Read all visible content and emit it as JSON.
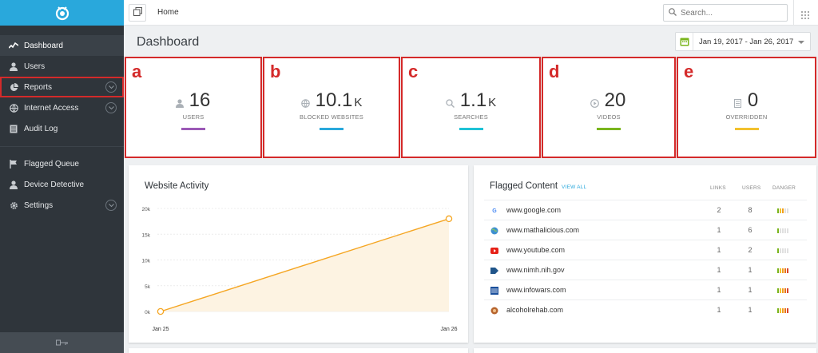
{
  "topbar": {
    "breadcrumb": "Home",
    "search_placeholder": "Search..."
  },
  "sidebar": {
    "items": [
      {
        "label": "Dashboard",
        "icon": "chart-line-icon"
      },
      {
        "label": "Users",
        "icon": "user-icon"
      },
      {
        "label": "Reports",
        "icon": "pie-chart-icon"
      },
      {
        "label": "Internet Access",
        "icon": "globe-icon"
      },
      {
        "label": "Audit Log",
        "icon": "list-icon"
      },
      {
        "label": "Flagged Queue",
        "icon": "flag-icon"
      },
      {
        "label": "Device Detective",
        "icon": "user-icon"
      },
      {
        "label": "Settings",
        "icon": "gear-icon"
      }
    ]
  },
  "header": {
    "title": "Dashboard",
    "date_range": "Jan 19, 2017 - Jan 26, 2017"
  },
  "stats": [
    {
      "letter": "a",
      "value": "16",
      "suffix": "",
      "label": "USERS",
      "color": "#9b59b6",
      "icon": "user-icon"
    },
    {
      "letter": "b",
      "value": "10.1",
      "suffix": "K",
      "label": "BLOCKED WEBSITES",
      "color": "#29a8dc",
      "icon": "globe-icon"
    },
    {
      "letter": "c",
      "value": "1.1",
      "suffix": "K",
      "label": "SEARCHES",
      "color": "#1fc2d6",
      "icon": "search-icon"
    },
    {
      "letter": "d",
      "value": "20",
      "suffix": "",
      "label": "VIDEOS",
      "color": "#7ab51d",
      "icon": "play-icon"
    },
    {
      "letter": "e",
      "value": "0",
      "suffix": "",
      "label": "OVERRIDDEN",
      "color": "#f2c12e",
      "icon": "document-icon"
    }
  ],
  "website_activity": {
    "title": "Website Activity",
    "chart_data": {
      "type": "area",
      "x": [
        "Jan 25",
        "Jan 26"
      ],
      "values": [
        0,
        18000
      ],
      "ylim": [
        0,
        20000
      ],
      "yticks": [
        "0k",
        "5k",
        "10k",
        "15k",
        "20k"
      ],
      "grid": true,
      "color": "#f5a623"
    }
  },
  "flagged_content": {
    "title": "Flagged Content",
    "view_all": "VIEW ALL",
    "columns": {
      "links": "LINKS",
      "users": "USERS",
      "danger": "DANGER"
    },
    "rows": [
      {
        "site": "www.google.com",
        "links": "2",
        "users": "8",
        "danger": 3,
        "icon": "google-icon"
      },
      {
        "site": "www.mathalicious.com",
        "links": "1",
        "users": "6",
        "danger": 1,
        "icon": "globe-icon"
      },
      {
        "site": "www.youtube.com",
        "links": "1",
        "users": "2",
        "danger": 1,
        "icon": "youtube-icon"
      },
      {
        "site": "www.nimh.nih.gov",
        "links": "1",
        "users": "1",
        "danger": 5,
        "icon": "nih-icon"
      },
      {
        "site": "www.infowars.com",
        "links": "1",
        "users": "1",
        "danger": 5,
        "icon": "infowars-icon"
      },
      {
        "site": "alcoholrehab.com",
        "links": "1",
        "users": "1",
        "danger": 5,
        "icon": "rehab-icon"
      }
    ]
  }
}
